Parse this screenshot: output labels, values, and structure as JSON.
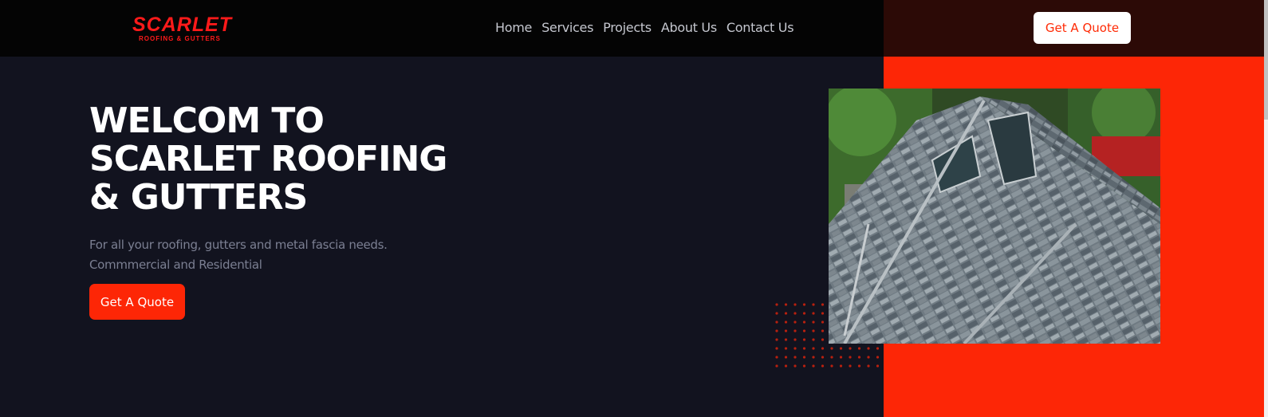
{
  "brand": {
    "name": "SCARLET",
    "tagline": "ROOFING & GUTTERS",
    "color": "#ff1a1a"
  },
  "nav": {
    "items": [
      {
        "label": "Home"
      },
      {
        "label": "Services"
      },
      {
        "label": "Projects"
      },
      {
        "label": "About Us"
      },
      {
        "label": "Contact Us"
      }
    ],
    "cta_label": "Get A Quote"
  },
  "hero": {
    "title_lines": [
      "WELCOM TO",
      "SCARLET ROOFING",
      "& GUTTERS"
    ],
    "subtitle_lines": [
      "For all your roofing, gutters and metal fascia needs.",
      "Commmercial and Residential"
    ],
    "cta_label": "Get A Quote",
    "image_icon": "roof-photo"
  },
  "colors": {
    "accent": "#fd2606",
    "dark_bg": "#12131f",
    "nav_bg": "#040404"
  }
}
